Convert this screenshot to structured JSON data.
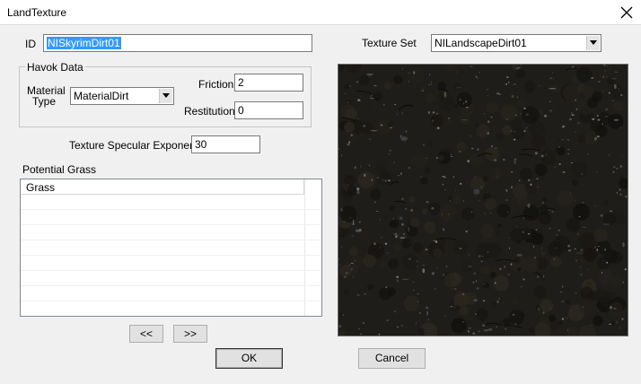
{
  "window": {
    "title": "LandTexture"
  },
  "id_field": {
    "label": "ID",
    "value": "NISkyrimDirt01"
  },
  "texture_set": {
    "label": "Texture Set",
    "value": "NILandscapeDirt01"
  },
  "havok": {
    "group_label": "Havok Data",
    "material_label_line1": "Material",
    "material_label_line2": "Type",
    "material_value": "MaterialDirt",
    "friction_label": "Friction",
    "friction_value": "2",
    "restitution_label": "Restitution",
    "restitution_value": "0"
  },
  "specular": {
    "label": "Texture Specular Exponent",
    "value": "30"
  },
  "grass": {
    "section_label": "Potential Grass",
    "column_header": "Grass",
    "rows": []
  },
  "buttons": {
    "prev": "<<",
    "next": ">>",
    "ok": "OK",
    "cancel": "Cancel"
  },
  "icons": {
    "close": "close-icon",
    "dropdown": "chevron-down-icon"
  },
  "colors": {
    "selection": "#3399ff",
    "preview_base": "#1f1d19"
  }
}
